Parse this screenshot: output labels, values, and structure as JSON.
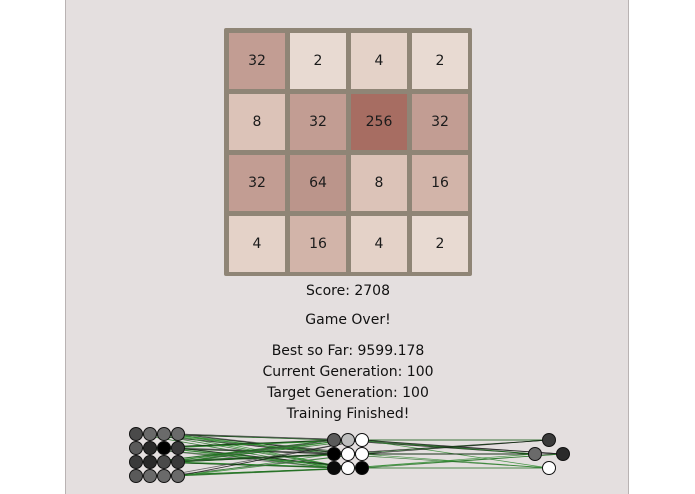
{
  "board": {
    "tiles": [
      [
        32,
        2,
        4,
        2
      ],
      [
        8,
        32,
        256,
        32
      ],
      [
        32,
        64,
        8,
        16
      ],
      [
        4,
        16,
        4,
        2
      ]
    ],
    "tile_colors": {
      "2": "#e8dad2",
      "4": "#e4d2c8",
      "8": "#dcc3b8",
      "16": "#d2b4a9",
      "32": "#c29d93",
      "64": "#bb958b",
      "256": "#a76d62"
    },
    "frame_color": "#8f8576"
  },
  "status": {
    "score": "Score: 2708",
    "game_state": "Game Over!",
    "best": "Best so Far: 9599.178",
    "current_generation": "Current Generation: 100",
    "target_generation": "Target Generation: 100",
    "training": "Training Finished!"
  },
  "network": {
    "input_layer": [
      [
        "#4a4a4a",
        "#6a6a6a",
        "#6a6a6a",
        "#6a6a6a"
      ],
      [
        "#5a5a5a",
        "#2a2a2a",
        "#000000",
        "#3a3a3a"
      ],
      [
        "#3a3a3a",
        "#2a2a2a",
        "#4a4a4a",
        "#3a3a3a"
      ],
      [
        "#5a5a5a",
        "#6a6a6a",
        "#6a6a6a",
        "#6a6a6a"
      ]
    ],
    "hidden_layer": [
      [
        "#5a5a5a",
        "#bdbdbd",
        "#ffffff"
      ],
      [
        "#000000",
        "#ffffff",
        "#ffffff"
      ],
      [
        "#0a0a0a",
        "#ffffff",
        "#000000"
      ]
    ],
    "output_layer": [
      "#3a3a3a",
      "#6a6a6a",
      "#2a2a2a",
      "#ffffff"
    ],
    "edge_colors": [
      "#2d8a2d",
      "#1e6b1e",
      "#111111",
      "#555555"
    ]
  }
}
